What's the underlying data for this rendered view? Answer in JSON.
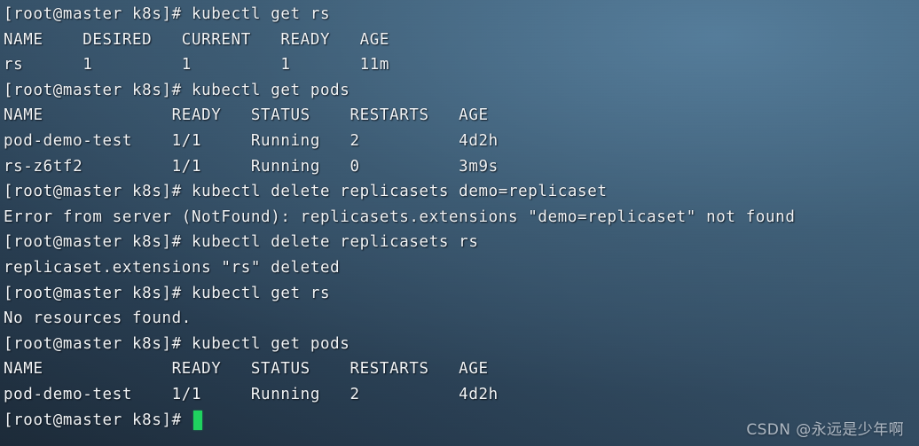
{
  "terminal": {
    "prompt": "[root@master k8s]# ",
    "cursor_color": "#1fd35f",
    "text_color": "#f2f5f7",
    "background_colors": {
      "light": "#456881",
      "mid": "#3d5b72",
      "dark": "#1c2a38"
    },
    "lines": [
      {
        "id": "l0",
        "kind": "command",
        "text": "[root@master k8s]# kubectl get rs"
      },
      {
        "id": "l1",
        "kind": "table-header",
        "text": "NAME    DESIRED   CURRENT   READY   AGE"
      },
      {
        "id": "l2",
        "kind": "table-row",
        "text": "rs      1         1         1       11m"
      },
      {
        "id": "l3",
        "kind": "command",
        "text": "[root@master k8s]# kubectl get pods"
      },
      {
        "id": "l4",
        "kind": "table-header",
        "text": "NAME             READY   STATUS    RESTARTS   AGE"
      },
      {
        "id": "l5",
        "kind": "table-row",
        "text": "pod-demo-test    1/1     Running   2          4d2h"
      },
      {
        "id": "l6",
        "kind": "table-row",
        "text": "rs-z6tf2         1/1     Running   0          3m9s"
      },
      {
        "id": "l7",
        "kind": "command",
        "text": "[root@master k8s]# kubectl delete replicasets demo=replicaset"
      },
      {
        "id": "l8",
        "kind": "error",
        "text": "Error from server (NotFound): replicasets.extensions \"demo=replicaset\" not found"
      },
      {
        "id": "l9",
        "kind": "command",
        "text": "[root@master k8s]# kubectl delete replicasets rs"
      },
      {
        "id": "l10",
        "kind": "output",
        "text": "replicaset.extensions \"rs\" deleted"
      },
      {
        "id": "l11",
        "kind": "command",
        "text": "[root@master k8s]# kubectl get rs"
      },
      {
        "id": "l12",
        "kind": "output",
        "text": "No resources found."
      },
      {
        "id": "l13",
        "kind": "command",
        "text": "[root@master k8s]# kubectl get pods"
      },
      {
        "id": "l14",
        "kind": "table-header",
        "text": "NAME             READY   STATUS    RESTARTS   AGE"
      },
      {
        "id": "l15",
        "kind": "table-row",
        "text": "pod-demo-test    1/1     Running   2          4d2h"
      },
      {
        "id": "l16",
        "kind": "prompt-active",
        "text": "[root@master k8s]# "
      }
    ]
  },
  "watermark": {
    "text": "CSDN @永远是少年啊"
  }
}
